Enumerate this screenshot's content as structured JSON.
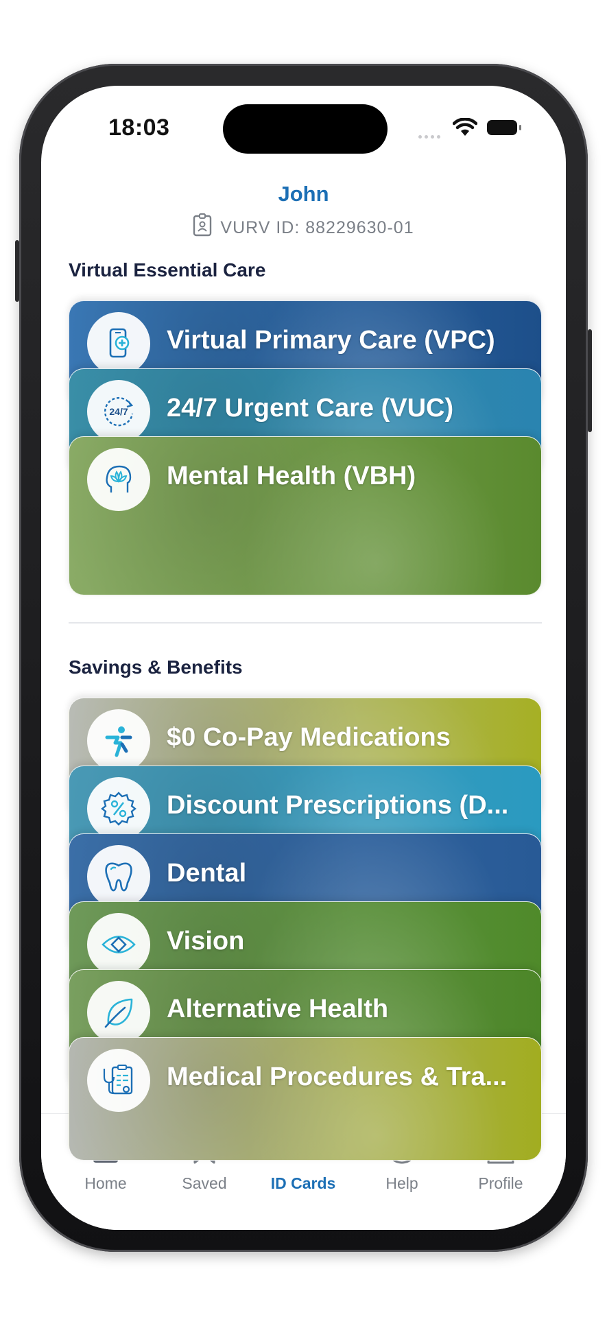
{
  "status_bar": {
    "time": "18:03"
  },
  "header": {
    "name": "John",
    "member_id": "VURV ID: 88229630-01"
  },
  "virtual_care": {
    "title": "Virtual Essential Care",
    "cards": [
      {
        "label": "Virtual Primary Care (VPC)",
        "icon": "phone-medical-icon",
        "color_a": "#3a78b5",
        "color_b": "#1d4f8a"
      },
      {
        "label": "24/7 Urgent Care (VUC)",
        "icon": "clock-24-7-icon",
        "color_a": "#3a8fa8",
        "color_b": "#2a84b0"
      },
      {
        "label": "Mental Health (VBH)",
        "icon": "lotus-head-icon",
        "color_a": "#8aab66",
        "color_b": "#5a8a2e"
      }
    ]
  },
  "savings": {
    "title": "Savings & Benefits",
    "cards": [
      {
        "label": "$0 Co-Pay Medications",
        "icon": "medical-person-icon",
        "color_a": "#b9bcb6",
        "color_b": "#a6b024"
      },
      {
        "label": "Discount Prescriptions (D...",
        "icon": "percent-badge-icon",
        "color_a": "#4a9ab6",
        "color_b": "#2a9ac0"
      },
      {
        "label": "Dental",
        "icon": "tooth-icon",
        "color_a": "#3b6fa8",
        "color_b": "#285a96"
      },
      {
        "label": "Vision",
        "icon": "eye-icon",
        "color_a": "#6f9a5a",
        "color_b": "#4f8a2a"
      },
      {
        "label": "Alternative Health",
        "icon": "leaf-icon",
        "color_a": "#7aa060",
        "color_b": "#4c8628"
      },
      {
        "label": "Medical Procedures & Tra...",
        "icon": "clipboard-stethoscope-icon",
        "color_a": "#b5b8b2",
        "color_b": "#a2ad20"
      }
    ]
  },
  "tab_bar": {
    "tabs": [
      {
        "label": "Home",
        "icon": "home-icon",
        "active": false
      },
      {
        "label": "Saved",
        "icon": "bookmark-icon",
        "active": false
      },
      {
        "label": "ID Cards",
        "icon": "id-card-icon",
        "active": true
      },
      {
        "label": "Help",
        "icon": "help-icon",
        "active": false
      },
      {
        "label": "Profile",
        "icon": "profile-icon",
        "active": false
      }
    ]
  },
  "colors": {
    "accent": "#1c6fb5",
    "heading": "#1b2340",
    "muted": "#7b8088"
  }
}
